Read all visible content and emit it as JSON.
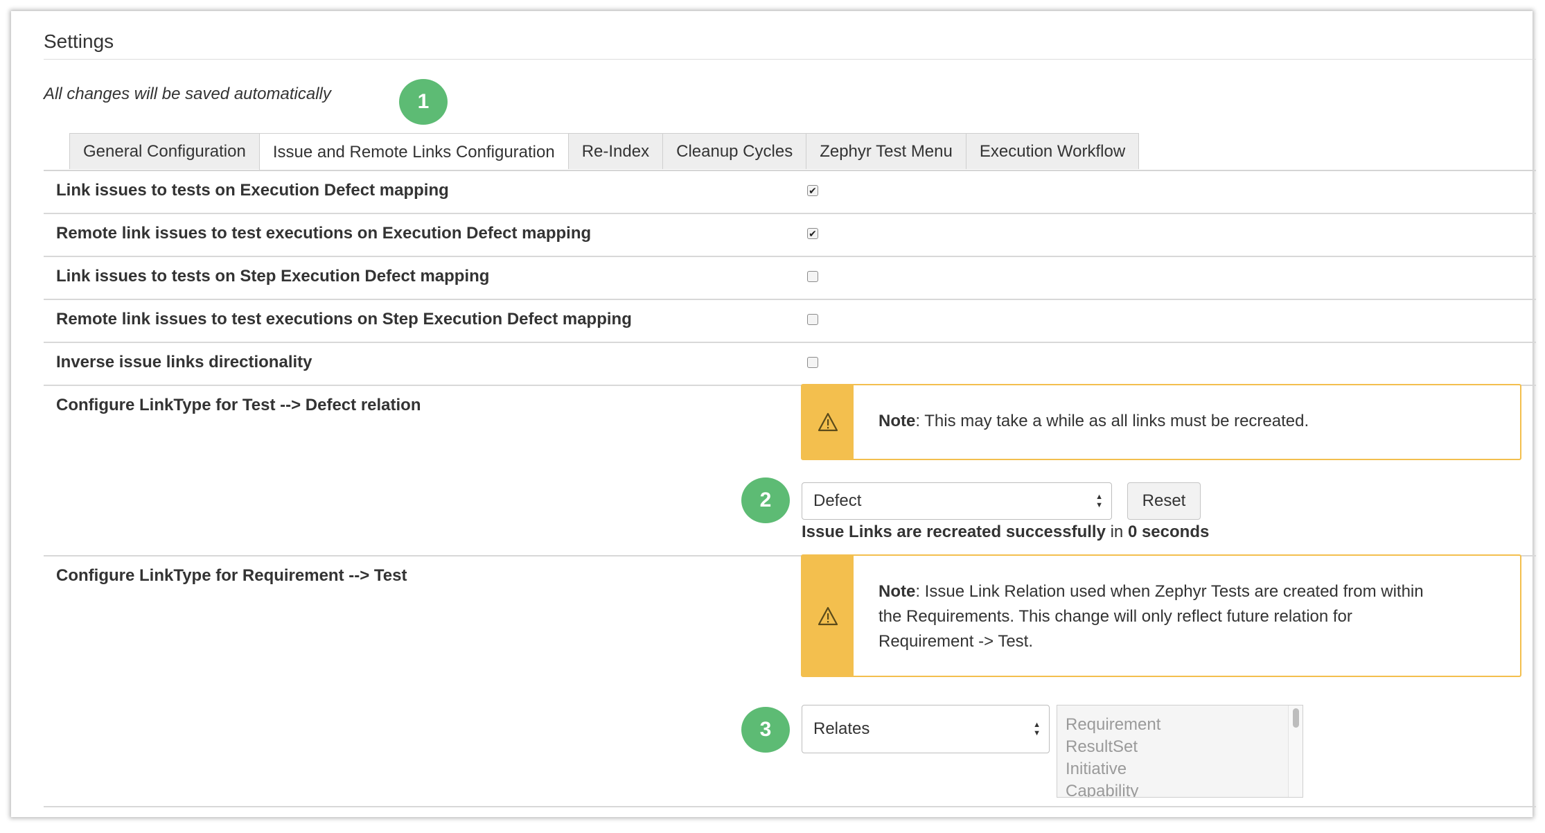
{
  "header": {
    "title": "Settings",
    "subtitle": "All changes will be saved automatically"
  },
  "badges": [
    "1",
    "2",
    "3"
  ],
  "tabs": [
    {
      "label": "General Configuration"
    },
    {
      "label": "Issue and Remote Links Configuration",
      "active": true
    },
    {
      "label": "Re-Index"
    },
    {
      "label": "Cleanup Cycles"
    },
    {
      "label": "Zephyr Test Menu"
    },
    {
      "label": "Execution Workflow"
    }
  ],
  "options": [
    {
      "label": "Link issues to tests on Execution Defect mapping",
      "checked": true
    },
    {
      "label": "Remote link issues to test executions on Execution Defect mapping",
      "checked": true
    },
    {
      "label": "Link issues to tests on Step Execution Defect mapping",
      "checked": false
    },
    {
      "label": "Remote link issues to test executions on Step Execution Defect mapping",
      "checked": false
    },
    {
      "label": "Inverse issue links directionality",
      "checked": false
    }
  ],
  "defect_relation": {
    "label": "Configure LinkType for Test --> Defect relation",
    "note_bold": "Note",
    "note_text": ": This may take a while as all links must be recreated.",
    "select_value": "Defect",
    "reset_label": "Reset",
    "status_bold": "Issue Links are recreated successfully",
    "status_mid": " in ",
    "status_time": "0 seconds"
  },
  "requirement_relation": {
    "label": "Configure LinkType for Requirement --> Test",
    "note_bold": "Note",
    "note_line1": ": Issue Link Relation used when Zephyr Tests are created from within",
    "note_line2": "the Requirements. This change will only reflect future relation for",
    "note_line3": "Requirement -> Test.",
    "select_value": "Relates",
    "issue_types": [
      "Requirement",
      "ResultSet",
      "Initiative",
      "Capability"
    ]
  },
  "colors": {
    "badge": "#5dbb74",
    "warning": "#f3bf4e"
  },
  "icons": {
    "warning": "warning-icon",
    "select_arrows": "up-down-arrows-icon",
    "checkmark": "checkmark-icon"
  }
}
